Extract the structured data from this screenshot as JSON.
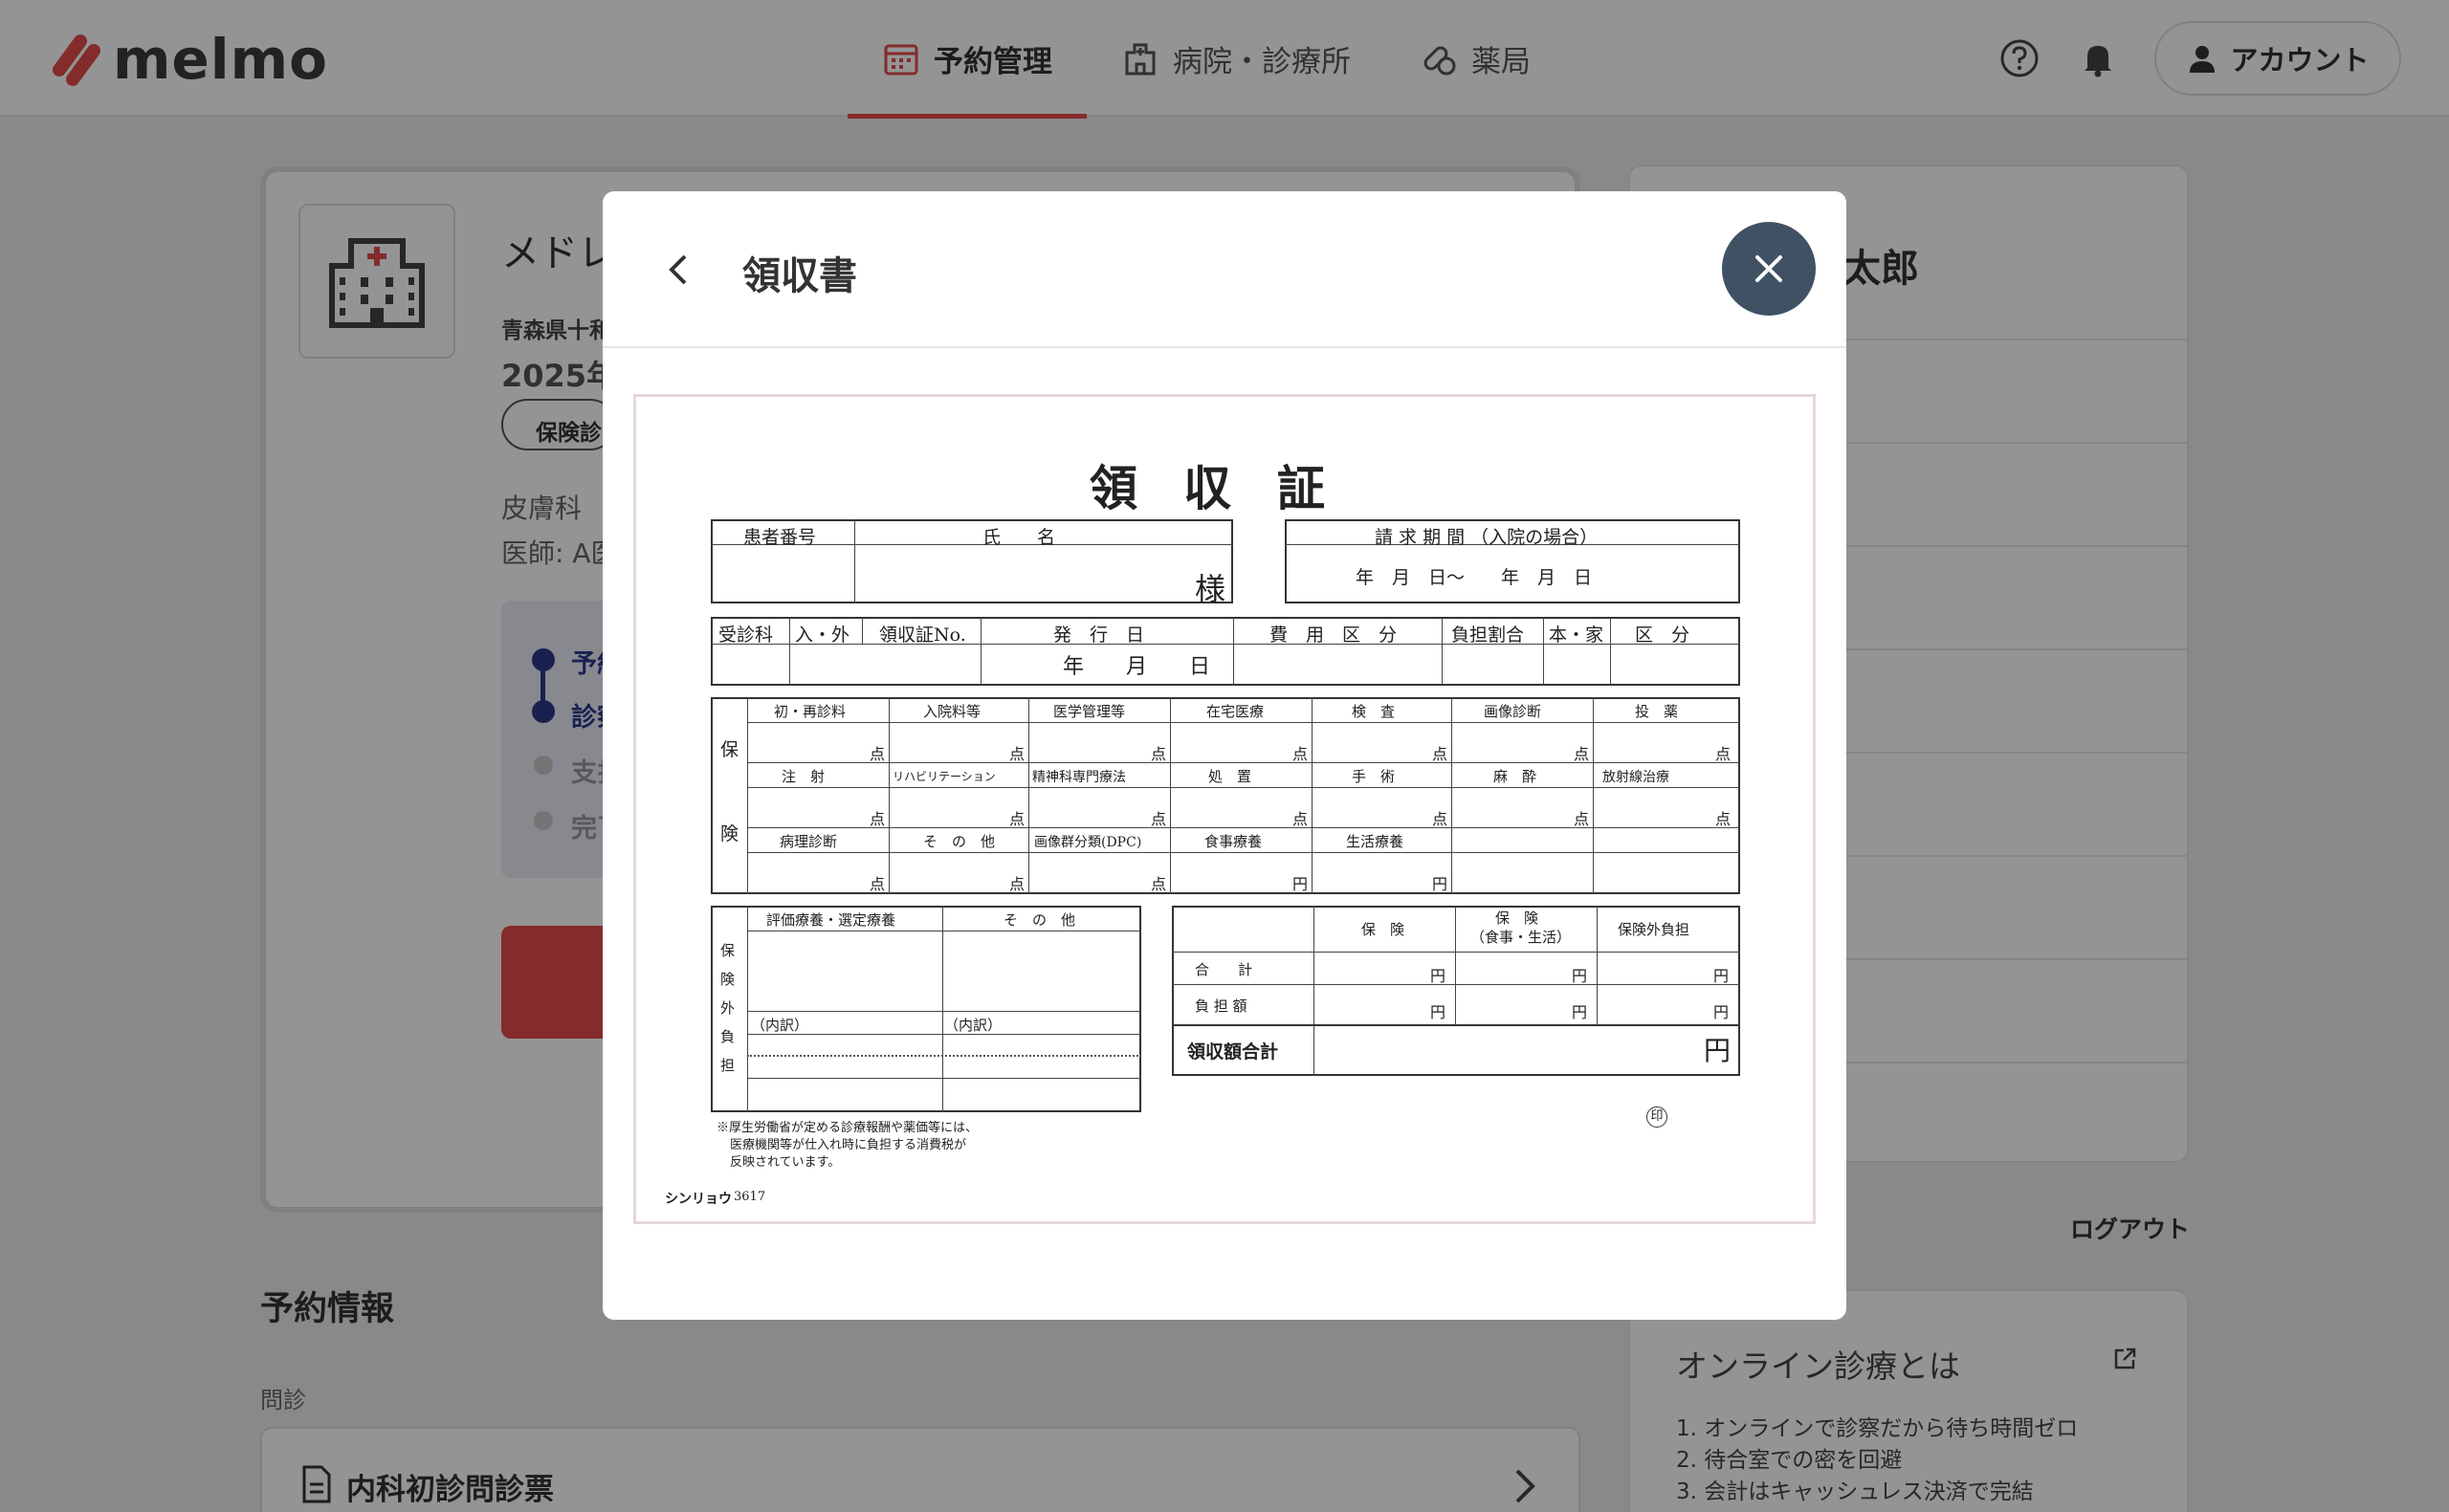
{
  "header": {
    "logo_text": "melmo",
    "nav": [
      {
        "label": "予約管理",
        "icon": "calendar-icon",
        "active": true
      },
      {
        "label": "病院・診療所",
        "icon": "hospital-icon",
        "active": false
      },
      {
        "label": "薬局",
        "icon": "pill-icon",
        "active": false
      }
    ],
    "account_label": "アカウント",
    "brand_color": "#e34a4a"
  },
  "background": {
    "hospital_name": "メドレ",
    "address": "青森県十和",
    "date": "2025年",
    "tag": "保険診",
    "department": "皮膚科",
    "doctor": "医師: A医",
    "steps": [
      "予約",
      "診察",
      "支払",
      "完了"
    ],
    "section_title": "予約情報",
    "section_sub": "問診",
    "form_label": "内科初診問診票",
    "user_name": "太郎",
    "logout": "ログアウト",
    "info_title": "オンライン診療とは",
    "info_items": [
      "1. オンラインで診察だから待ち時間ゼロ",
      "2. 待合室での密を回避",
      "3. 会計はキャッシュレス決済で完結"
    ]
  },
  "modal": {
    "title": "領収書",
    "receipt": {
      "title": "領収証",
      "patient_number": "患者番号",
      "name": "氏　　名",
      "honorific": "様",
      "billing_period": "請 求 期 間 （入院の場合）",
      "period_values": "年　月　日～　　年　月　日",
      "row2_headers": [
        "受診科",
        "入・外",
        "領収証No.",
        "発　行　日",
        "費　用　区　分",
        "負担割合",
        "本・家",
        "区　分"
      ],
      "issue_date": "年　　月　　日",
      "insurance_side": [
        "保",
        "険"
      ],
      "grid_row1": [
        "初・再診料",
        "入院料等",
        "医学管理等",
        "在宅医療",
        "検　査",
        "画像診断",
        "投　薬"
      ],
      "grid_row2": [
        "注　射",
        "リハビリテーション",
        "精神科専門療法",
        "処　置",
        "手　術",
        "麻　酔",
        "放射線治療"
      ],
      "grid_row3": [
        "病理診断",
        "そ　の　他",
        "画像群分類(DPC)",
        "食事療養",
        "生活療養"
      ],
      "unit_point": "点",
      "unit_yen": "円",
      "out_of_ins_side": [
        "保",
        "険",
        "外",
        "負",
        "担"
      ],
      "out_of_ins_headers": [
        "評価療養・選定療養",
        "そ　の　他"
      ],
      "breakdown": [
        "（内訳）",
        "（内訳）"
      ],
      "totals_headers": [
        "保　険",
        "保　険",
        "（食事・生活）",
        "保険外負担"
      ],
      "totals_rows": [
        "合　　計",
        "負 担 額"
      ],
      "grand_total": "領収額合計",
      "note_lines": [
        "※厚生労働省が定める診療報酬や薬価等には、",
        "医療機関等が仕入れ時に負担する消費税が",
        "反映されています。"
      ],
      "publisher": "シンリョウ",
      "form_number": "3617",
      "seal": "印"
    }
  }
}
